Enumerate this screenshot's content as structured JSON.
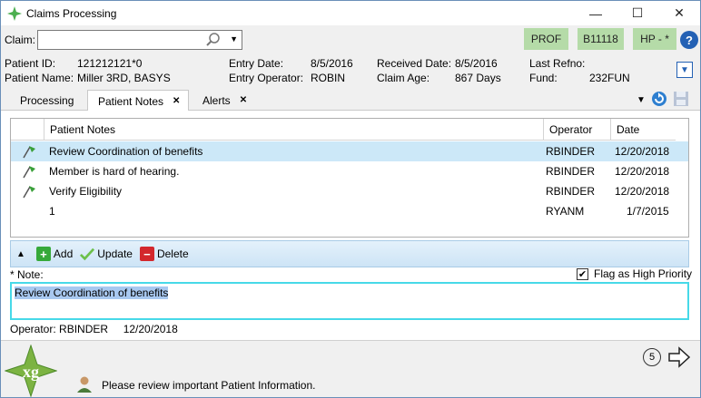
{
  "window": {
    "title": "Claims Processing",
    "minimize_glyph": "—",
    "maximize_glyph": "☐",
    "close_glyph": "✕"
  },
  "claim_bar": {
    "label": "Claim:",
    "input_value": "",
    "tags": [
      "PROF",
      "B11118",
      "HP - *"
    ],
    "help_label": "?"
  },
  "patient_info": {
    "patient_id_label": "Patient ID:",
    "patient_id": "121212121*0",
    "patient_name_label": "Patient Name:",
    "patient_name": "Miller 3RD, BASYS",
    "entry_date_label": "Entry Date:",
    "entry_date": "8/5/2016",
    "entry_operator_label": "Entry Operator:",
    "entry_operator": "ROBIN",
    "received_date_label": "Received Date:",
    "received_date": "8/5/2016",
    "claim_age_label": "Claim Age:",
    "claim_age": "867 Days",
    "last_refno_label": "Last Refno:",
    "last_refno": "",
    "fund_label": "Fund:",
    "fund": "232FUN"
  },
  "tabs": [
    {
      "label": "Processing",
      "closable": false,
      "active": false
    },
    {
      "label": "Patient Notes",
      "closable": true,
      "active": true
    },
    {
      "label": "Alerts",
      "closable": true,
      "active": false
    }
  ],
  "tab_close_glyph": "✕",
  "notes_grid": {
    "columns": [
      "Patient Notes",
      "Operator",
      "Date"
    ],
    "rows": [
      {
        "note": "Review Coordination of benefits",
        "operator": "RBINDER",
        "date": "12/20/2018",
        "flagged": true,
        "selected": true
      },
      {
        "note": "Member is hard of hearing.",
        "operator": "RBINDER",
        "date": "12/20/2018",
        "flagged": true,
        "selected": false
      },
      {
        "note": "Verify Eligibility",
        "operator": "RBINDER",
        "date": "12/20/2018",
        "flagged": true,
        "selected": false
      },
      {
        "note": "1",
        "operator": "RYANM",
        "date": "1/7/2015",
        "flagged": false,
        "selected": false
      }
    ]
  },
  "actions": {
    "collapse_glyph": "▲",
    "add_label": "Add",
    "update_label": "Update",
    "delete_label": "Delete"
  },
  "note_editor": {
    "label": "* Note:",
    "value": "Review Coordination of benefits",
    "flag_label": "Flag as High Priority",
    "flag_checked": true,
    "operator_line": "Operator: RBINDER     12/20/2018"
  },
  "footer": {
    "logo_text": "xg",
    "status_message": "Please review important Patient Information.",
    "queue_count": "5"
  },
  "colors": {
    "accent_blue": "#2461b4",
    "tag_green": "#b5dba8",
    "selected_row": "#cce8f8",
    "note_border": "#47d9e8",
    "flag_green": "#3aa03a",
    "add_green": "#36a93a",
    "delete_red": "#d3272c"
  }
}
